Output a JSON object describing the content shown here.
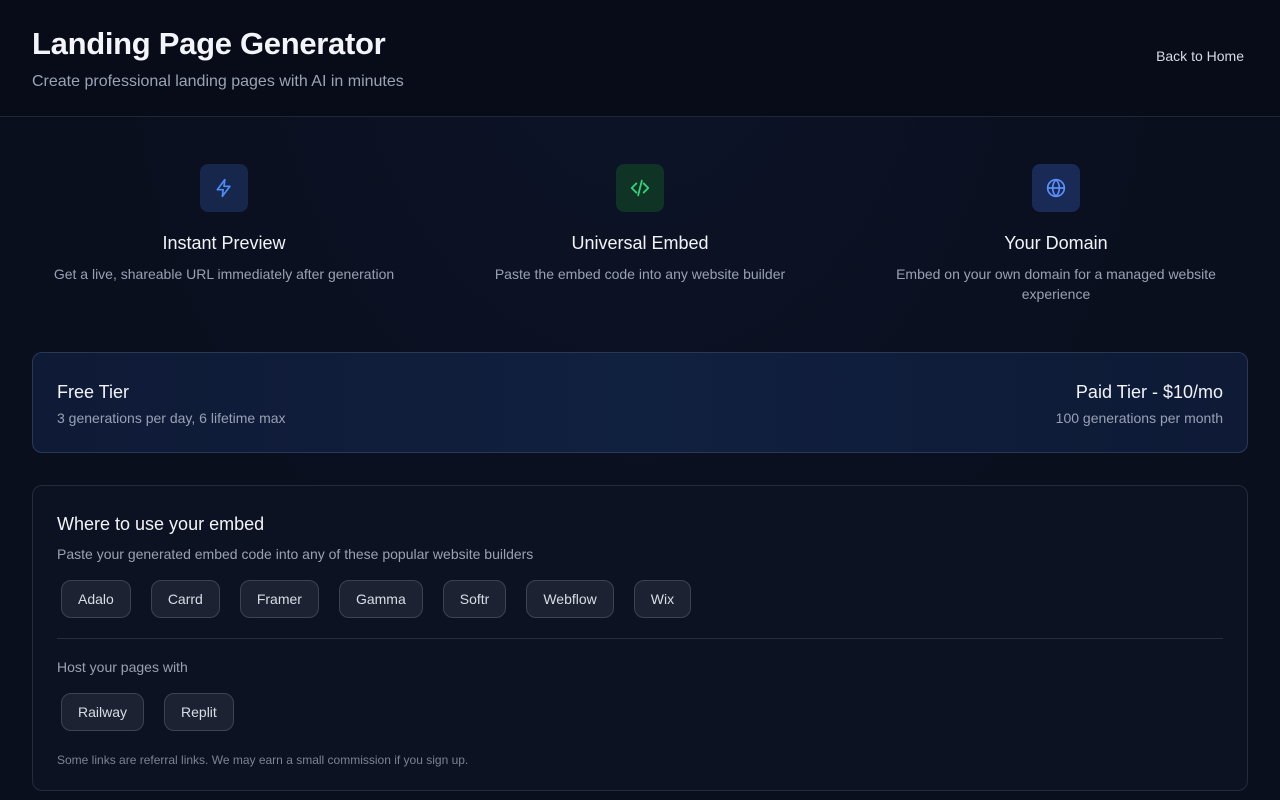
{
  "header": {
    "title": "Landing Page Generator",
    "subtitle": "Create professional landing pages with AI in minutes",
    "back_link": "Back to Home"
  },
  "features": [
    {
      "icon": "lightning-icon",
      "title": "Instant Preview",
      "description": "Get a live, shareable URL immediately after generation"
    },
    {
      "icon": "code-icon",
      "title": "Universal Embed",
      "description": "Paste the embed code into any website builder"
    },
    {
      "icon": "globe-icon",
      "title": "Your Domain",
      "description": "Embed on your own domain for a managed website experience"
    }
  ],
  "tiers": {
    "free": {
      "title": "Free Tier",
      "detail": "3 generations per day, 6 lifetime max"
    },
    "paid": {
      "title": "Paid Tier - $10/mo",
      "detail": "100 generations per month"
    }
  },
  "embed": {
    "title": "Where to use your embed",
    "description": "Paste your generated embed code into any of these popular website builders",
    "builders": [
      "Adalo",
      "Carrd",
      "Framer",
      "Gamma",
      "Softr",
      "Webflow",
      "Wix"
    ],
    "host_label": "Host your pages with",
    "hosts": [
      "Railway",
      "Replit"
    ],
    "note": "Some links are referral links. We may earn a small commission if you sign up."
  },
  "colors": {
    "background": "#0a0f1e",
    "accent_blue": "#4f8dfb",
    "accent_green": "#34d27b"
  }
}
